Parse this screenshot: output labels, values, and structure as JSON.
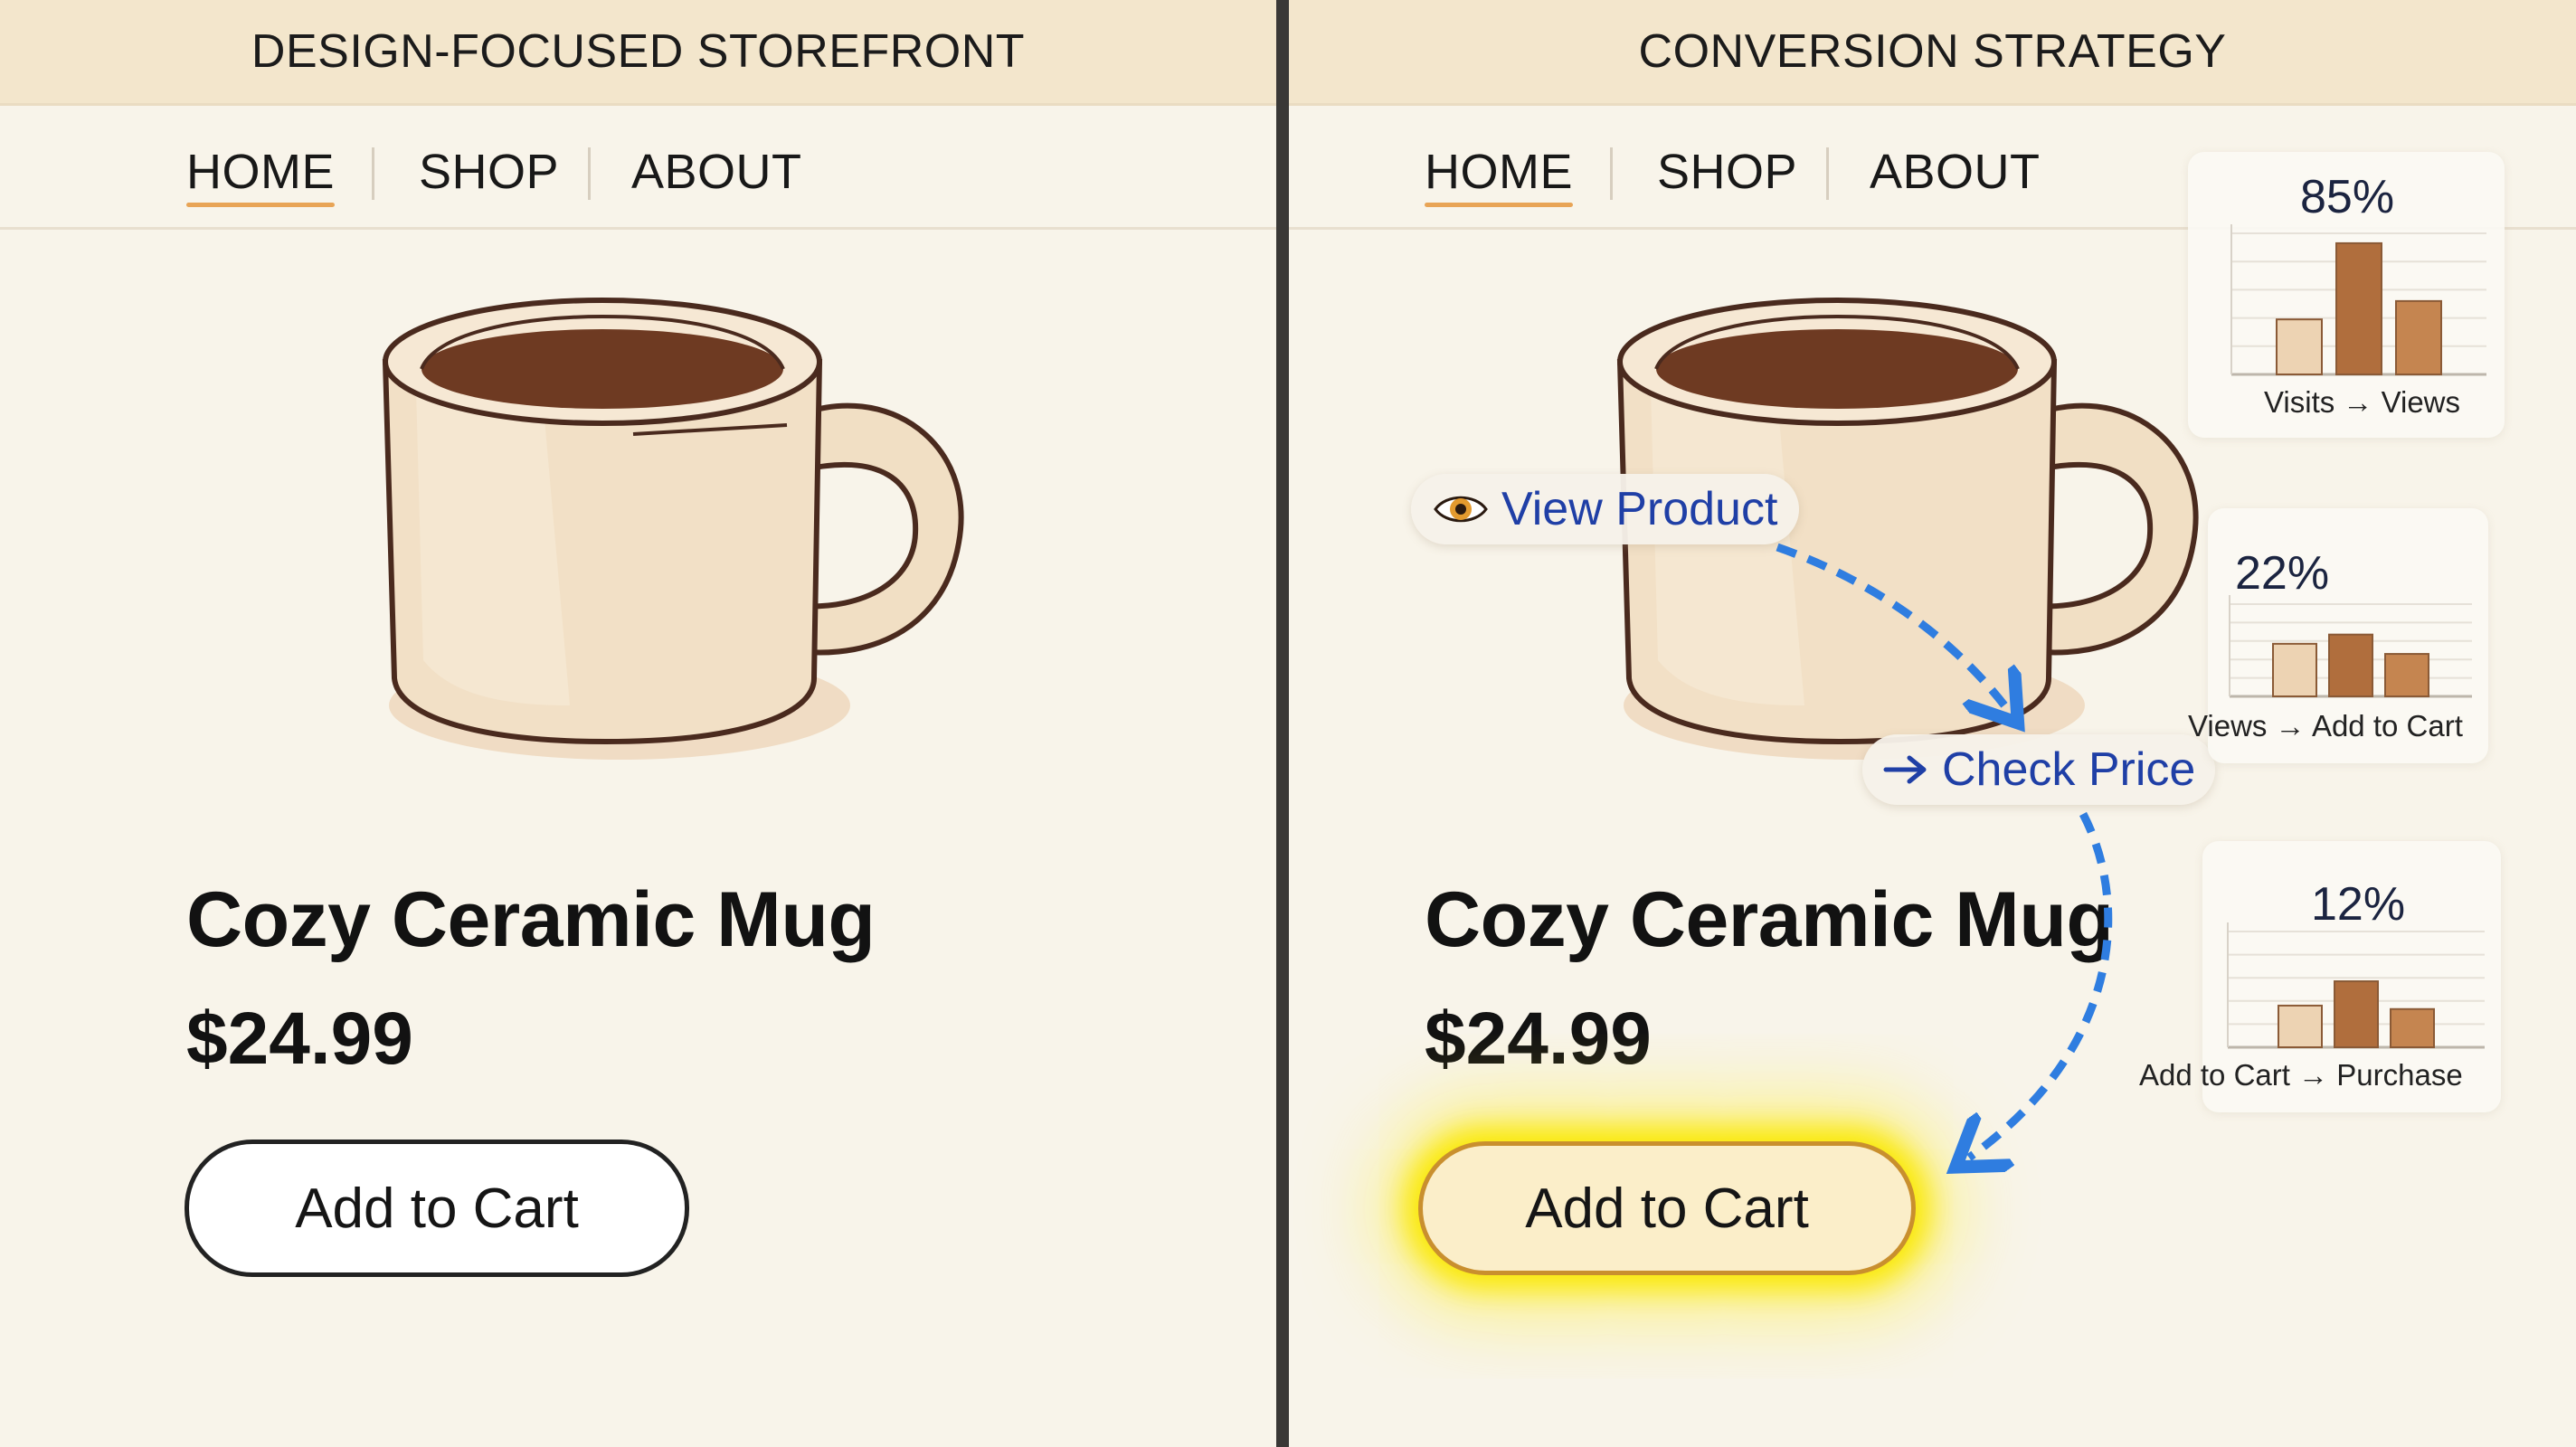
{
  "left_panel": {
    "header_title": "DESIGN-FOCUSED STOREFRONT",
    "nav": [
      {
        "label": "HOME",
        "active": true
      },
      {
        "label": "SHOP",
        "active": false
      },
      {
        "label": "ABOUT",
        "active": false
      }
    ],
    "product": {
      "name": "Cozy Ceramic Mug",
      "price": "$24.99"
    },
    "cart_button": {
      "label": "Add to Cart"
    }
  },
  "right_panel": {
    "header_title": "CONVERSION STRATEGY",
    "nav": [
      {
        "label": "HOME",
        "active": true
      },
      {
        "label": "SHOP",
        "active": false
      },
      {
        "label": "ABOUT",
        "active": false
      }
    ],
    "product": {
      "name": "Cozy Ceramic Mug",
      "price": "$24.99"
    },
    "cart_button": {
      "label": "Add to Cart"
    },
    "journey": [
      {
        "label": "View Product",
        "icon": "eye-icon"
      },
      {
        "label": "Check Price",
        "icon": "arrow-right-icon"
      }
    ],
    "funnel": [
      {
        "percent": "85%",
        "label": "Visits → Views"
      },
      {
        "percent": "22%",
        "label": "Views → Add to Cart"
      },
      {
        "percent": "12%",
        "label": "Add to Cart → Purchase"
      }
    ]
  },
  "colors": {
    "header_bg": "#f3e6cc",
    "panel_bg": "#f8f4ea",
    "nav_active_underline": "#e8a456",
    "journey_text": "#1f3fa6",
    "flow_arrow": "#2f7de0",
    "cart_glow": "#f5e400",
    "cart_border_highlight": "#c98f2e",
    "bar_light": "#edd3b3",
    "bar_dark": "#b06e3d",
    "bar_mid": "#c58550"
  },
  "chart_data": [
    {
      "type": "bar",
      "categories": [
        "",
        "",
        ""
      ],
      "values": [
        0.39,
        0.93,
        0.52
      ],
      "title": "85%",
      "xlabel": "Visits → Views",
      "ylabel": "",
      "ylim": [
        0,
        1
      ],
      "grid": true
    },
    {
      "type": "bar",
      "categories": [
        "",
        "",
        ""
      ],
      "values": [
        0.57,
        0.67,
        0.46
      ],
      "title": "22%",
      "xlabel": "Views → Add to Cart",
      "ylabel": "",
      "ylim": [
        0,
        1
      ],
      "grid": true
    },
    {
      "type": "bar",
      "categories": [
        "",
        "",
        ""
      ],
      "values": [
        0.36,
        0.57,
        0.33
      ],
      "title": "12%",
      "xlabel": "Add to Cart → Purchase",
      "ylabel": "",
      "ylim": [
        0,
        1
      ],
      "grid": true
    }
  ]
}
